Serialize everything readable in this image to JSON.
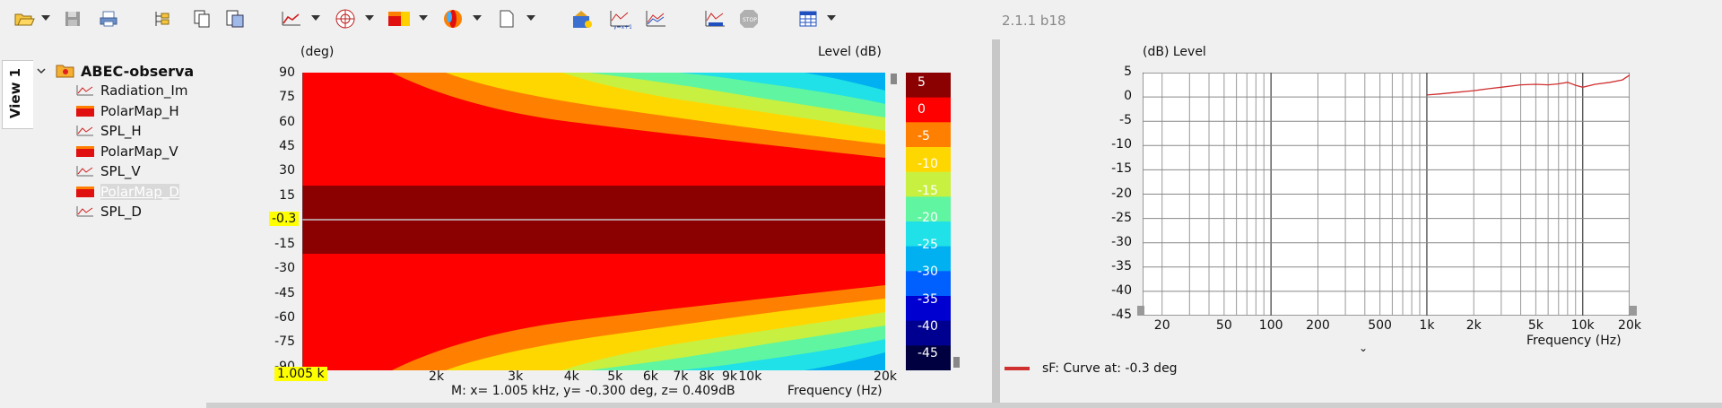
{
  "toolbar": {
    "icons": [
      "open-icon",
      "save-icon",
      "print-icon",
      "tree-icon",
      "copy-icon",
      "copy-special-icon",
      "graph-icon",
      "polar-icon",
      "polarmap-icon",
      "balloon-icon",
      "page-icon",
      "run-icon",
      "xy-graph-icon",
      "multi-graph-icon",
      "graph-calc-icon",
      "stop-icon",
      "grid-icon"
    ],
    "version": "2.1.1 b18"
  },
  "view_tab": {
    "label": "View 1"
  },
  "tree": {
    "root": "ABEC-observa",
    "items": [
      {
        "label": "Radiation_Im",
        "type": "graph"
      },
      {
        "label": "PolarMap_H",
        "type": "polarmap"
      },
      {
        "label": "SPL_H",
        "type": "graph"
      },
      {
        "label": "PolarMap_V",
        "type": "polarmap"
      },
      {
        "label": "SPL_V",
        "type": "graph"
      },
      {
        "label": "PolarMap_D",
        "type": "polarmap",
        "selected": true
      },
      {
        "label": "SPL_D",
        "type": "graph"
      }
    ]
  },
  "polar_plot": {
    "y_unit": "(deg)",
    "z_label": "Level  (dB)",
    "x_label": "Frequency  (Hz)",
    "y_ticks": [
      "90",
      "75",
      "60",
      "45",
      "30",
      "15",
      "-15",
      "-30",
      "-45",
      "-60",
      "-75",
      "-90"
    ],
    "x_ticks": [
      "2k",
      "3k",
      "4k",
      "5k",
      "6k",
      "7k",
      "8k",
      "9k",
      "10k",
      "20k"
    ],
    "colorbar_ticks": [
      "5",
      "0",
      "-5",
      "-10",
      "-15",
      "-20",
      "-25",
      "-30",
      "-35",
      "-40",
      "-45"
    ],
    "colors": [
      "#8b0000",
      "#ff0000",
      "#ff8000",
      "#ffd700",
      "#c8f040",
      "#60f5a0",
      "#20e0e8",
      "#00b0f0",
      "#0060ff",
      "#0000d0",
      "#000090",
      "#000040"
    ],
    "marker_y": "-0.3",
    "marker_x": "1.005 k",
    "status": "M:  x= 1.005 kHz,  y= -0.300 deg, z= 0.409dB"
  },
  "response_plot": {
    "y_label": "(dB)  Level",
    "x_label": "Frequency  (Hz)",
    "y_ticks": [
      "5",
      "0",
      "-5",
      "-10",
      "-15",
      "-20",
      "-25",
      "-30",
      "-35",
      "-40",
      "-45"
    ],
    "x_ticks": [
      "20",
      "50",
      "100",
      "200",
      "500",
      "1k",
      "2k",
      "5k",
      "10k",
      "20k"
    ],
    "legend": "sF: Curve at: -0.3 deg",
    "curve_color": "#d03030"
  },
  "chart_data": {
    "type": "line",
    "title": "",
    "xlabel": "Frequency  (Hz)",
    "ylabel": "(dB)  Level",
    "xscale": "log",
    "xlim": [
      15,
      20000
    ],
    "ylim": [
      -45,
      5
    ],
    "grid": true,
    "legend_position": "bottom-left",
    "series": [
      {
        "name": "sF: Curve at: -0.3 deg",
        "color": "#d03030",
        "x": [
          1000,
          1200,
          1500,
          2000,
          2500,
          3000,
          4000,
          5000,
          6000,
          7000,
          8000,
          9000,
          10000,
          12000,
          15000,
          18000,
          20000
        ],
        "y": [
          0.4,
          0.6,
          0.9,
          1.3,
          1.7,
          2.0,
          2.5,
          2.6,
          2.5,
          2.7,
          3.0,
          2.4,
          2.0,
          2.6,
          3.0,
          3.5,
          4.5
        ]
      }
    ]
  }
}
